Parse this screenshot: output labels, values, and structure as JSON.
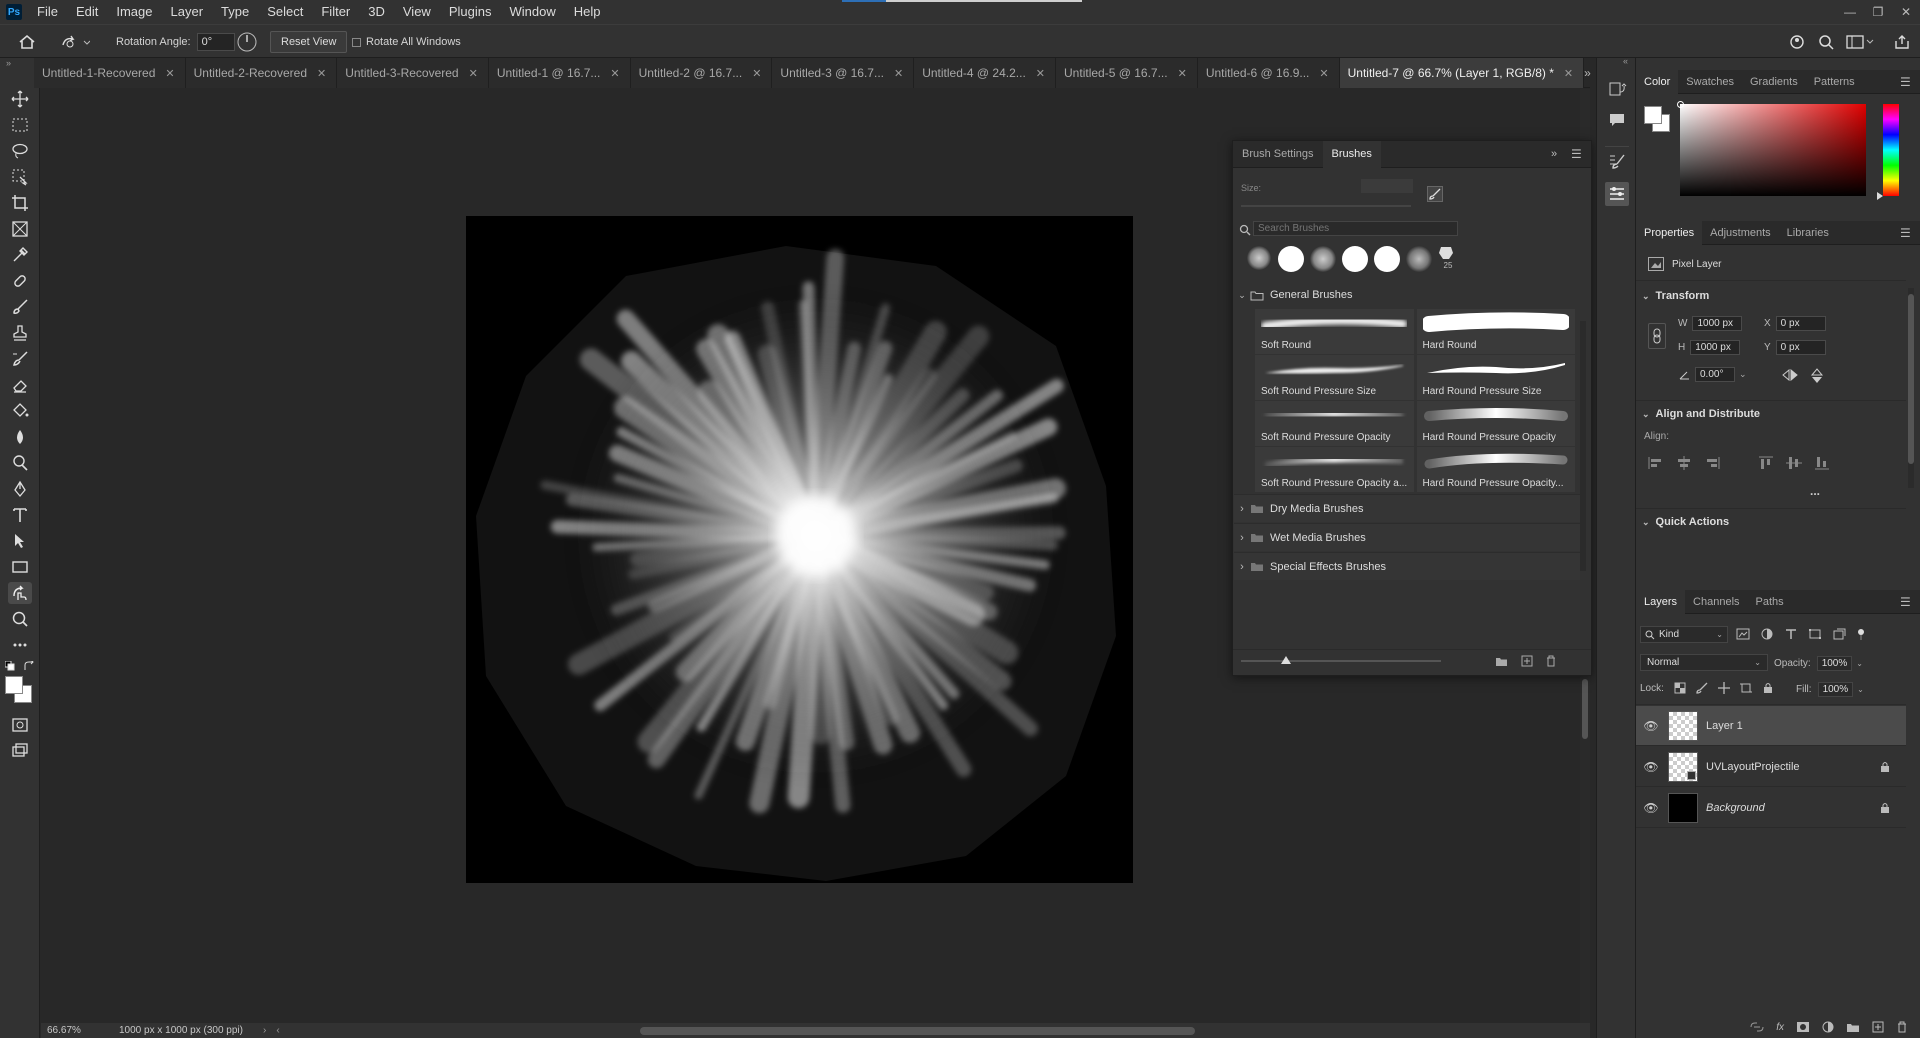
{
  "app": {
    "logo": "Ps"
  },
  "menu": [
    "File",
    "Edit",
    "Image",
    "Layer",
    "Type",
    "Select",
    "Filter",
    "3D",
    "View",
    "Plugins",
    "Window",
    "Help"
  ],
  "options": {
    "rotation_label": "Rotation Angle:",
    "rotation_value": "0°",
    "reset_view": "Reset View",
    "rotate_all": "Rotate All Windows"
  },
  "tabs": [
    {
      "label": "Untitled-1-Recovered",
      "active": false
    },
    {
      "label": "Untitled-2-Recovered",
      "active": false
    },
    {
      "label": "Untitled-3-Recovered",
      "active": false
    },
    {
      "label": "Untitled-1 @ 16.7...",
      "active": false
    },
    {
      "label": "Untitled-2 @ 16.7...",
      "active": false
    },
    {
      "label": "Untitled-3 @ 16.7...",
      "active": false
    },
    {
      "label": "Untitled-4 @ 24.2...",
      "active": false
    },
    {
      "label": "Untitled-5 @ 16.7...",
      "active": false
    },
    {
      "label": "Untitled-6 @ 16.9...",
      "active": false
    },
    {
      "label": "Untitled-7 @ 66.7% (Layer 1, RGB/8) *",
      "active": true
    }
  ],
  "status": {
    "zoom": "66.67%",
    "doc_info": "1000 px x 1000 px (300 ppi)"
  },
  "brush_panel": {
    "tabs": [
      "Brush Settings",
      "Brushes"
    ],
    "size_label": "Size:",
    "search_placeholder": "Search Brushes",
    "preset_count": "25",
    "general_folder": "General Brushes",
    "brushes": [
      "Soft Round",
      "Hard Round",
      "Soft Round Pressure Size",
      "Hard Round Pressure Size",
      "Soft Round Pressure Opacity",
      "Hard Round Pressure Opacity",
      "Soft Round Pressure Opacity a...",
      "Hard Round Pressure Opacity..."
    ],
    "folders": [
      "Dry Media Brushes",
      "Wet Media Brushes",
      "Special Effects Brushes"
    ]
  },
  "color_panel": {
    "tabs": [
      "Color",
      "Swatches",
      "Gradients",
      "Patterns"
    ]
  },
  "properties": {
    "tabs": [
      "Properties",
      "Adjustments",
      "Libraries"
    ],
    "layer_type": "Pixel Layer",
    "transform_title": "Transform",
    "w_label": "W",
    "w_value": "1000 px",
    "h_label": "H",
    "h_value": "1000 px",
    "x_label": "X",
    "x_value": "0 px",
    "y_label": "Y",
    "y_value": "0 px",
    "angle_value": "0.00°",
    "align_title": "Align and Distribute",
    "align_label": "Align:",
    "more": "...",
    "quick_actions": "Quick Actions"
  },
  "layers": {
    "tabs": [
      "Layers",
      "Channels",
      "Paths"
    ],
    "kind": "Kind",
    "blend": "Normal",
    "opacity_label": "Opacity:",
    "opacity_value": "100%",
    "lock_label": "Lock:",
    "fill_label": "Fill:",
    "fill_value": "100%",
    "items": [
      {
        "name": "Layer 1",
        "selected": true,
        "locked": false
      },
      {
        "name": "UVLayoutProjectile",
        "selected": false,
        "locked": true
      },
      {
        "name": "Background",
        "selected": false,
        "locked": true
      }
    ]
  },
  "colors": {
    "accent": "#31a8ff",
    "panel": "#323232",
    "canvas_bg": "#282828"
  }
}
